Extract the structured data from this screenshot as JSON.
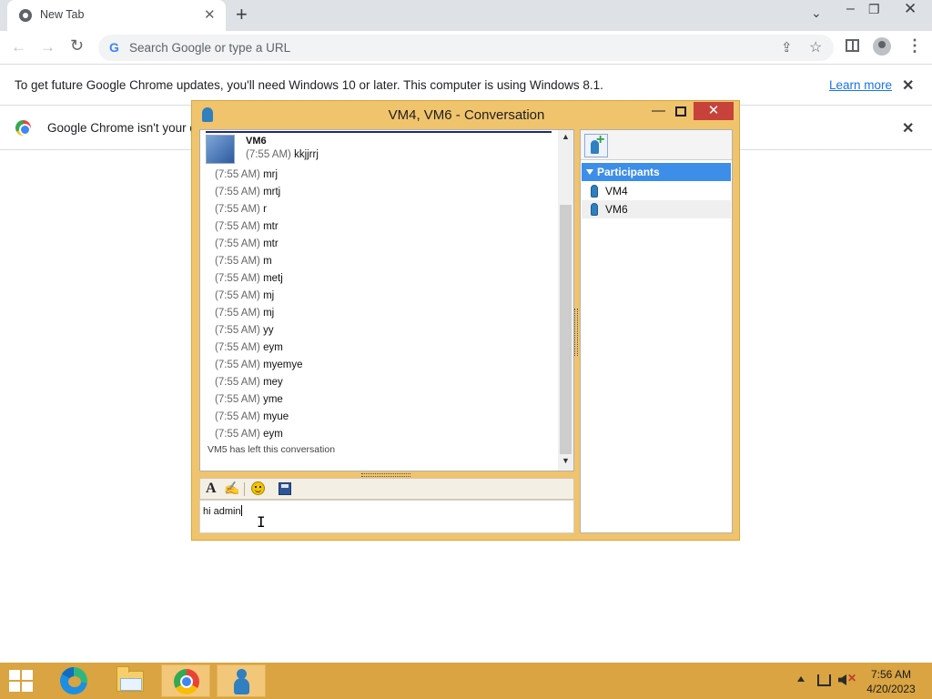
{
  "browser": {
    "tab_title": "New Tab",
    "omnibox_placeholder": "Search Google or type a URL",
    "infobar_update_text": "To get future Google Chrome updates, you'll need Windows 10 or later. This computer is using Windows 8.1.",
    "learn_more": "Learn more",
    "infobar_default_text": "Google Chrome isn't your d"
  },
  "conversation": {
    "title": "VM4, VM6 - Conversation",
    "sender": "VM6",
    "first_message": {
      "time": "(7:55 AM)",
      "text": "kkjjrrj"
    },
    "messages": [
      {
        "time": "(7:55 AM)",
        "text": "mrj"
      },
      {
        "time": "(7:55 AM)",
        "text": "mrtj"
      },
      {
        "time": "(7:55 AM)",
        "text": "r"
      },
      {
        "time": "(7:55 AM)",
        "text": "mtr"
      },
      {
        "time": "(7:55 AM)",
        "text": "mtr"
      },
      {
        "time": "(7:55 AM)",
        "text": "m"
      },
      {
        "time": "(7:55 AM)",
        "text": "metj"
      },
      {
        "time": "(7:55 AM)",
        "text": "mj"
      },
      {
        "time": "(7:55 AM)",
        "text": "mj"
      },
      {
        "time": "(7:55 AM)",
        "text": "yy"
      },
      {
        "time": "(7:55 AM)",
        "text": "eym"
      },
      {
        "time": "(7:55 AM)",
        "text": "myemye"
      },
      {
        "time": "(7:55 AM)",
        "text": "mey"
      },
      {
        "time": "(7:55 AM)",
        "text": "yme"
      },
      {
        "time": "(7:55 AM)",
        "text": "myue"
      },
      {
        "time": "(7:55 AM)",
        "text": "eym"
      }
    ],
    "system_message": "VM5 has left this conversation",
    "input_value": "hi admin",
    "participants_header": "Participants",
    "participants": [
      "VM4",
      "VM6"
    ]
  },
  "taskbar": {
    "time": "7:56 AM",
    "date": "4/20/2023"
  },
  "colors": {
    "window_frame": "#f0c36d",
    "taskbar": "#d9a441",
    "participants_header": "#3d8ee8",
    "close_button": "#c7423a"
  }
}
